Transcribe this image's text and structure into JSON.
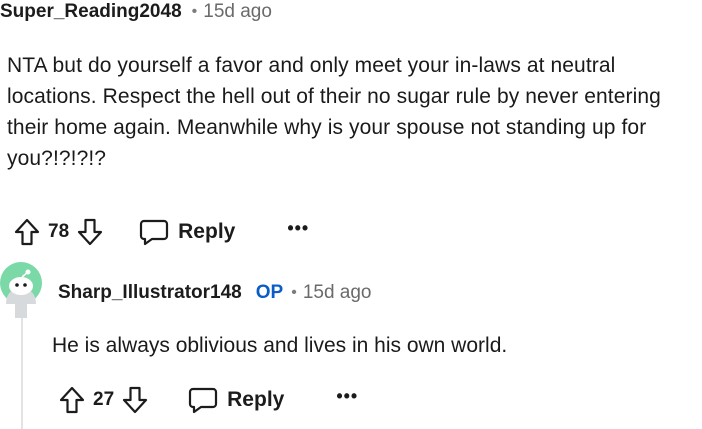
{
  "comment": {
    "username": "Super_Reading2048",
    "separator": "•",
    "time": "15d ago",
    "body": "NTA but do yourself a favor and only meet your in-laws at neutral locations. Respect the hell out of their no sugar rule by never entering their home again. Meanwhile why is your spouse not standing up for you?!?!?!?",
    "score": "78",
    "reply_label": "Reply",
    "more_label": "•••"
  },
  "reply": {
    "username": "Sharp_Illustrator148",
    "badge": "OP",
    "separator": "•",
    "time": "15d ago",
    "body": "He is always oblivious and lives in his own world.",
    "score": "27",
    "reply_label": "Reply",
    "more_label": "•••"
  },
  "colors": {
    "op_badge": "#0b5cc7",
    "avatar_bg": "#7bd9a7",
    "thread_line": "#e3e3e3",
    "meta_text": "#6a6a6a"
  }
}
